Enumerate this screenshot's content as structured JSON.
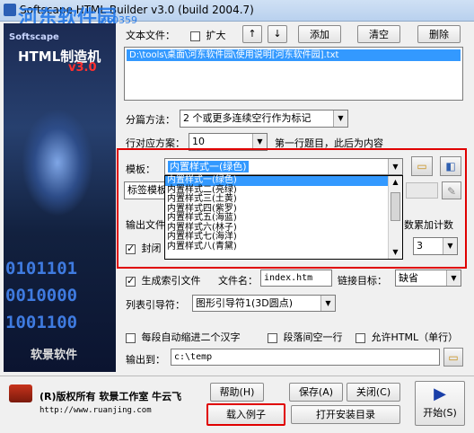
{
  "window": {
    "title": "Softscape HTML Builder v3.0 (build 2004.7)",
    "watermark": "河东软件园",
    "watermark_url": "pc0359"
  },
  "leftpanel": {
    "logo1": "Softscape",
    "logo2": "HTML制造机",
    "version": "v3.0",
    "binary": [
      "0101101",
      "0010000",
      "1001100"
    ],
    "brand": "软景软件"
  },
  "files": {
    "label": "文本文件：",
    "expand_label": "扩大",
    "add_label": "添加",
    "clear_label": "清空",
    "delete_label": "删除",
    "items": [
      "D:\\tools\\桌面\\河东软件园\\使用说明[河东软件园].txt"
    ]
  },
  "split": {
    "label": "分篇方法：",
    "value": "2 个或更多连续空行作为标记"
  },
  "line": {
    "label": "行对应方案：",
    "value": "10",
    "note": "第一行题目，此后为内容"
  },
  "template": {
    "label": "模板：",
    "value": "内置样式一(绿色)",
    "options": [
      "内置样式一(绿色)",
      "内置样式二(亮绿)",
      "内置样式三(土黄)",
      "内置样式四(紫罗)",
      "内置样式五(海蓝)",
      "内置样式六(林子)",
      "内置样式七(海洋)",
      "内置样式八(青黛)"
    ]
  },
  "tags": {
    "label": "标签模板",
    "output_label": "输出文件",
    "seal_label": "封闭",
    "count_label": "数累加计数",
    "count_value": "3"
  },
  "index": {
    "gen_label": "生成索引文件",
    "filename_label": "文件名：",
    "filename_value": "index.htm",
    "link_label": "链接目标：",
    "link_value": "缺省"
  },
  "list": {
    "label": "列表引导符：",
    "value": "图形引导符1(3D圆点)"
  },
  "opts": {
    "indent": "每段自动缩进二个汉字",
    "blank": "段落间空一行",
    "html": "允许HTML（单行）"
  },
  "output": {
    "label": "输出到：",
    "value": "c:\\temp"
  },
  "footer": {
    "copyright": "(R)版权所有 软景工作室 牛云飞",
    "url": "http://www.ruanjing.com",
    "help": "帮助(H)",
    "save": "保存(A)",
    "close": "关闭(C)",
    "load": "载入例子",
    "open_dir": "打开安装目录",
    "start": "开始(S)"
  }
}
